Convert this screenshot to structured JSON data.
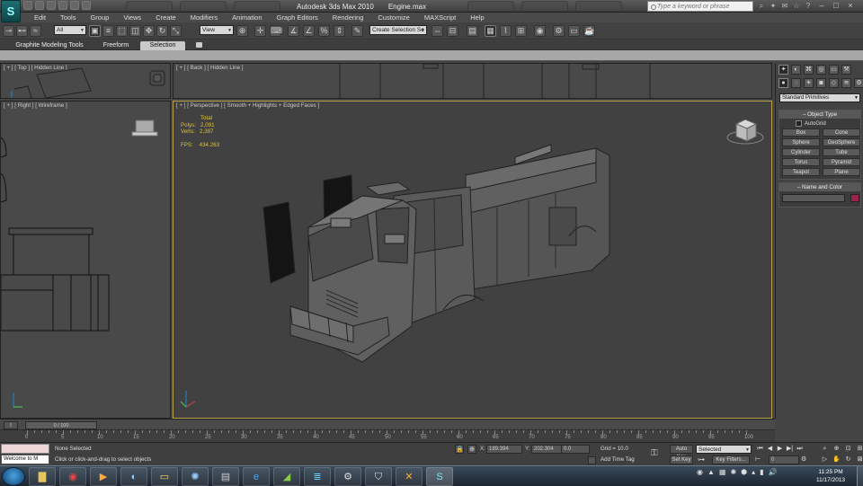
{
  "title": {
    "app_logo": "S",
    "app_name": "Autodesk 3ds Max  2010",
    "file_name": "Engine.max",
    "search_placeholder": "Type a keyword or phrase"
  },
  "menu": [
    "Edit",
    "Tools",
    "Group",
    "Views",
    "Create",
    "Modifiers",
    "Animation",
    "Graph Editors",
    "Rendering",
    "Customize",
    "MAXScript",
    "Help"
  ],
  "toolbar": {
    "selection_filter": "All",
    "reference_coord": "View",
    "named_selection": "Create Selection Se"
  },
  "ribbon": {
    "tabs": [
      "Graphite Modeling Tools",
      "Freeform",
      "Selection"
    ],
    "active_tab": "Selection"
  },
  "viewports": {
    "top": "[ + ] [ Top ] [ Hidden Line ]",
    "back": "[ + ] [ Back ] [ Hidden Line ]",
    "right": "[ + ] [ Right ] [ Wireframe ]",
    "perspective": "[ + ] [ Perspective ] [ Smooth + Highlights + Edged Faces ]"
  },
  "stats": {
    "total_label": "Total",
    "polys_label": "Polys:",
    "polys": "2,091",
    "verts_label": "Verts:",
    "verts": "2,387",
    "fps_label": "FPS:",
    "fps": "434.263"
  },
  "command_panel": {
    "category": "Standard Primitives",
    "object_type_title": "Object Type",
    "autogrid": "AutoGrid",
    "primitives": [
      "Box",
      "Cone",
      "Sphere",
      "GeoSphere",
      "Cylinder",
      "Tube",
      "Torus",
      "Pyramid",
      "Teapot",
      "Plane"
    ],
    "name_color_title": "Name and Color",
    "swatch_color": "#a0214b"
  },
  "timeline": {
    "slider": "0 / 100",
    "ticks": [
      "0",
      "5",
      "10",
      "15",
      "20",
      "25",
      "30",
      "35",
      "40",
      "45",
      "50",
      "55",
      "60",
      "65",
      "70",
      "75",
      "80",
      "85",
      "90",
      "95",
      "100"
    ]
  },
  "status": {
    "maxscript_text": "Welcome to M",
    "selection": "None Selected",
    "prompt": "Click or click-and-drag to select objects",
    "x_label": "X:",
    "x": "189.394",
    "y_label": "Y:",
    "y": "202.304",
    "z_label": "Z:",
    "z": "0.0",
    "grid": "Grid = 10.0",
    "add_time_tag": "Add Time Tag",
    "auto_key": "Auto Key",
    "set_key": "Set Key",
    "key_mode": "Selected",
    "key_filters": "Key Filters...",
    "frame": "0"
  },
  "taskbar": {
    "time": "11:25 PM",
    "date": "11/17/2013"
  }
}
